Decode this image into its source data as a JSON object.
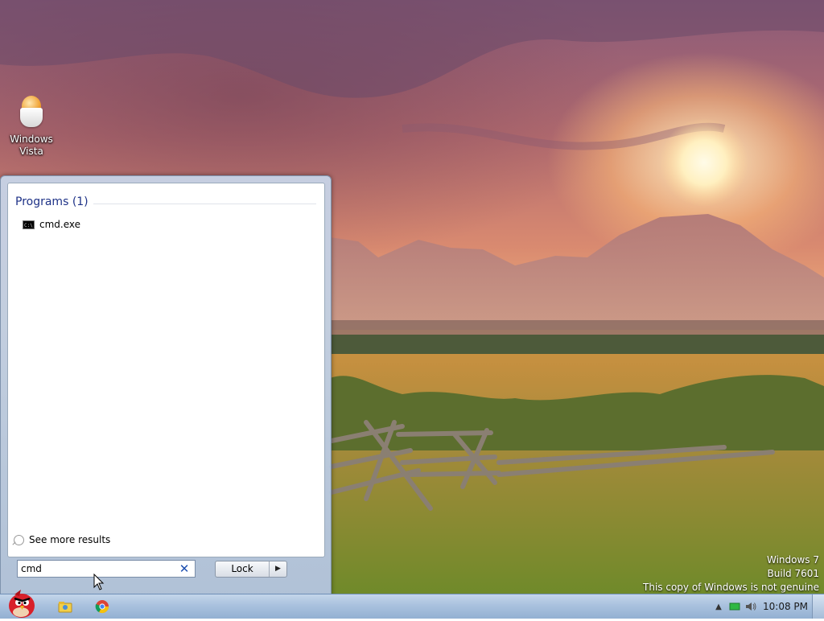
{
  "desktop": {
    "icon_label": "Windows Vista"
  },
  "start_menu": {
    "group_header": "Programs (1)",
    "results": [
      {
        "label": "cmd.exe",
        "icon": "command-prompt-icon"
      }
    ],
    "see_more_label": "See more results",
    "search_value": "cmd",
    "lock_label": "Lock"
  },
  "watermark": {
    "line1": "Windows 7",
    "line2": "Build 7601",
    "line3": "This copy of Windows is not genuine"
  },
  "taskbar": {
    "pinned": [
      "angry-birds-icon",
      "windows-explorer-icon",
      "chrome-icon"
    ],
    "tray_icons": [
      "show-hidden-icons-arrow",
      "network-icon",
      "volume-icon"
    ],
    "clock": "10:08 PM"
  }
}
